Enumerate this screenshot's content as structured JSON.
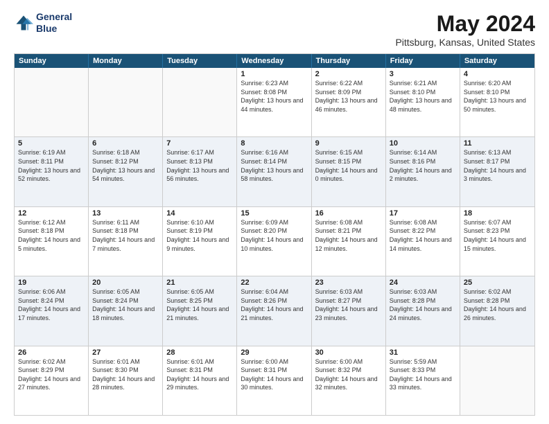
{
  "header": {
    "logo_line1": "General",
    "logo_line2": "Blue",
    "title": "May 2024",
    "subtitle": "Pittsburg, Kansas, United States"
  },
  "days_of_week": [
    "Sunday",
    "Monday",
    "Tuesday",
    "Wednesday",
    "Thursday",
    "Friday",
    "Saturday"
  ],
  "weeks": [
    [
      {
        "day": "",
        "sunrise": "",
        "sunset": "",
        "daylight": ""
      },
      {
        "day": "",
        "sunrise": "",
        "sunset": "",
        "daylight": ""
      },
      {
        "day": "",
        "sunrise": "",
        "sunset": "",
        "daylight": ""
      },
      {
        "day": "1",
        "sunrise": "Sunrise: 6:23 AM",
        "sunset": "Sunset: 8:08 PM",
        "daylight": "Daylight: 13 hours and 44 minutes."
      },
      {
        "day": "2",
        "sunrise": "Sunrise: 6:22 AM",
        "sunset": "Sunset: 8:09 PM",
        "daylight": "Daylight: 13 hours and 46 minutes."
      },
      {
        "day": "3",
        "sunrise": "Sunrise: 6:21 AM",
        "sunset": "Sunset: 8:10 PM",
        "daylight": "Daylight: 13 hours and 48 minutes."
      },
      {
        "day": "4",
        "sunrise": "Sunrise: 6:20 AM",
        "sunset": "Sunset: 8:10 PM",
        "daylight": "Daylight: 13 hours and 50 minutes."
      }
    ],
    [
      {
        "day": "5",
        "sunrise": "Sunrise: 6:19 AM",
        "sunset": "Sunset: 8:11 PM",
        "daylight": "Daylight: 13 hours and 52 minutes."
      },
      {
        "day": "6",
        "sunrise": "Sunrise: 6:18 AM",
        "sunset": "Sunset: 8:12 PM",
        "daylight": "Daylight: 13 hours and 54 minutes."
      },
      {
        "day": "7",
        "sunrise": "Sunrise: 6:17 AM",
        "sunset": "Sunset: 8:13 PM",
        "daylight": "Daylight: 13 hours and 56 minutes."
      },
      {
        "day": "8",
        "sunrise": "Sunrise: 6:16 AM",
        "sunset": "Sunset: 8:14 PM",
        "daylight": "Daylight: 13 hours and 58 minutes."
      },
      {
        "day": "9",
        "sunrise": "Sunrise: 6:15 AM",
        "sunset": "Sunset: 8:15 PM",
        "daylight": "Daylight: 14 hours and 0 minutes."
      },
      {
        "day": "10",
        "sunrise": "Sunrise: 6:14 AM",
        "sunset": "Sunset: 8:16 PM",
        "daylight": "Daylight: 14 hours and 2 minutes."
      },
      {
        "day": "11",
        "sunrise": "Sunrise: 6:13 AM",
        "sunset": "Sunset: 8:17 PM",
        "daylight": "Daylight: 14 hours and 3 minutes."
      }
    ],
    [
      {
        "day": "12",
        "sunrise": "Sunrise: 6:12 AM",
        "sunset": "Sunset: 8:18 PM",
        "daylight": "Daylight: 14 hours and 5 minutes."
      },
      {
        "day": "13",
        "sunrise": "Sunrise: 6:11 AM",
        "sunset": "Sunset: 8:18 PM",
        "daylight": "Daylight: 14 hours and 7 minutes."
      },
      {
        "day": "14",
        "sunrise": "Sunrise: 6:10 AM",
        "sunset": "Sunset: 8:19 PM",
        "daylight": "Daylight: 14 hours and 9 minutes."
      },
      {
        "day": "15",
        "sunrise": "Sunrise: 6:09 AM",
        "sunset": "Sunset: 8:20 PM",
        "daylight": "Daylight: 14 hours and 10 minutes."
      },
      {
        "day": "16",
        "sunrise": "Sunrise: 6:08 AM",
        "sunset": "Sunset: 8:21 PM",
        "daylight": "Daylight: 14 hours and 12 minutes."
      },
      {
        "day": "17",
        "sunrise": "Sunrise: 6:08 AM",
        "sunset": "Sunset: 8:22 PM",
        "daylight": "Daylight: 14 hours and 14 minutes."
      },
      {
        "day": "18",
        "sunrise": "Sunrise: 6:07 AM",
        "sunset": "Sunset: 8:23 PM",
        "daylight": "Daylight: 14 hours and 15 minutes."
      }
    ],
    [
      {
        "day": "19",
        "sunrise": "Sunrise: 6:06 AM",
        "sunset": "Sunset: 8:24 PM",
        "daylight": "Daylight: 14 hours and 17 minutes."
      },
      {
        "day": "20",
        "sunrise": "Sunrise: 6:05 AM",
        "sunset": "Sunset: 8:24 PM",
        "daylight": "Daylight: 14 hours and 18 minutes."
      },
      {
        "day": "21",
        "sunrise": "Sunrise: 6:05 AM",
        "sunset": "Sunset: 8:25 PM",
        "daylight": "Daylight: 14 hours and 21 minutes."
      },
      {
        "day": "22",
        "sunrise": "Sunrise: 6:04 AM",
        "sunset": "Sunset: 8:26 PM",
        "daylight": "Daylight: 14 hours and 21 minutes."
      },
      {
        "day": "23",
        "sunrise": "Sunrise: 6:03 AM",
        "sunset": "Sunset: 8:27 PM",
        "daylight": "Daylight: 14 hours and 23 minutes."
      },
      {
        "day": "24",
        "sunrise": "Sunrise: 6:03 AM",
        "sunset": "Sunset: 8:28 PM",
        "daylight": "Daylight: 14 hours and 24 minutes."
      },
      {
        "day": "25",
        "sunrise": "Sunrise: 6:02 AM",
        "sunset": "Sunset: 8:28 PM",
        "daylight": "Daylight: 14 hours and 26 minutes."
      }
    ],
    [
      {
        "day": "26",
        "sunrise": "Sunrise: 6:02 AM",
        "sunset": "Sunset: 8:29 PM",
        "daylight": "Daylight: 14 hours and 27 minutes."
      },
      {
        "day": "27",
        "sunrise": "Sunrise: 6:01 AM",
        "sunset": "Sunset: 8:30 PM",
        "daylight": "Daylight: 14 hours and 28 minutes."
      },
      {
        "day": "28",
        "sunrise": "Sunrise: 6:01 AM",
        "sunset": "Sunset: 8:31 PM",
        "daylight": "Daylight: 14 hours and 29 minutes."
      },
      {
        "day": "29",
        "sunrise": "Sunrise: 6:00 AM",
        "sunset": "Sunset: 8:31 PM",
        "daylight": "Daylight: 14 hours and 30 minutes."
      },
      {
        "day": "30",
        "sunrise": "Sunrise: 6:00 AM",
        "sunset": "Sunset: 8:32 PM",
        "daylight": "Daylight: 14 hours and 32 minutes."
      },
      {
        "day": "31",
        "sunrise": "Sunrise: 5:59 AM",
        "sunset": "Sunset: 8:33 PM",
        "daylight": "Daylight: 14 hours and 33 minutes."
      },
      {
        "day": "",
        "sunrise": "",
        "sunset": "",
        "daylight": ""
      }
    ]
  ]
}
